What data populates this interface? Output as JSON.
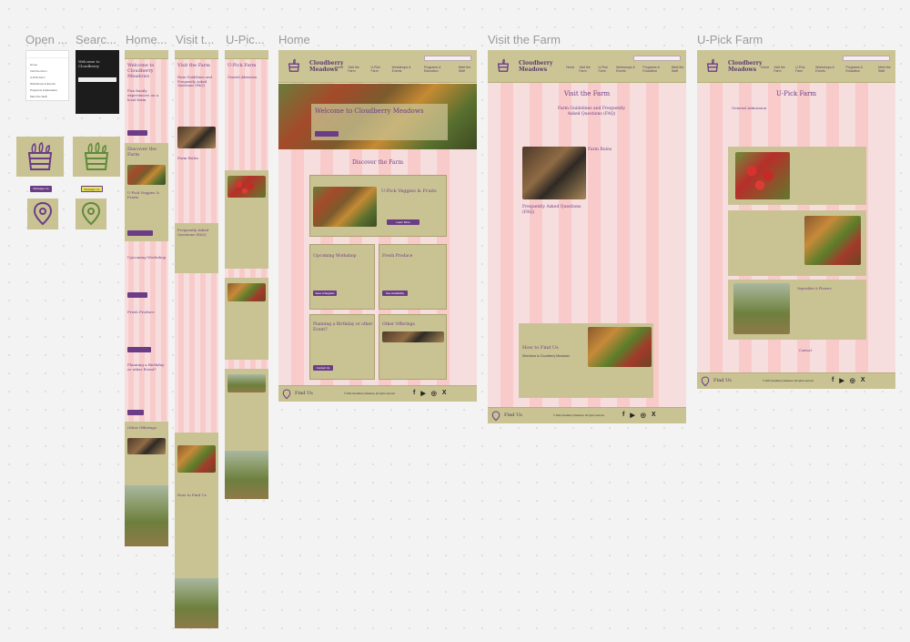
{
  "frame_labels": {
    "open": "Open ...",
    "search": "Searc...",
    "home_mobile": "Home...",
    "visit_mobile": "Visit t...",
    "upick_mobile": "U-Pic...",
    "home": "Home",
    "visit": "Visit the Farm",
    "upick": "U-Pick Farm"
  },
  "brand": {
    "line1": "Cloudberry",
    "line2": "Meadows"
  },
  "nav": [
    "Home",
    "Visit the Farm",
    "U-Pick Farm",
    "Workshops & Events",
    "Programs & Education",
    "Meet the Staff"
  ],
  "components": {
    "message_btn_purple": "Message me",
    "message_btn_yellow": "Message me"
  },
  "home": {
    "hero_title": "Welcome to Cloudberry Meadows",
    "discover_title": "Discover the Farm",
    "upick_title": "U-Pick Veggies & Fruits",
    "upick_btn": "Learn More",
    "workshop_title": "Upcoming Workshop",
    "workshop_btn": "Save A Register",
    "fresh_title": "Fresh Produce",
    "fresh_btn": "See Availability",
    "planning_title": "Planning a Birthday or other Event?",
    "planning_btn": "Contact Us",
    "other_title": "Other Offerings"
  },
  "visit": {
    "title": "Visit the Farm",
    "faq_title": "Farm Guidelines and Frequently Asked Questions (FAQ)",
    "farm_rules": "Farm Rules",
    "faq2": "Frequently Asked Questions (FAQ)",
    "find_us": "How to Find Us",
    "directions": "Directions to Cloudberry Meadows"
  },
  "upick": {
    "title": "U-Pick Farm",
    "admission": "General Admission",
    "veggies": "Vegetables & Flowers",
    "contact": "Contact"
  },
  "mobile": {
    "home_title": "Welcome to Cloudberry Meadows",
    "home_sub": "Fun family experiences on a local farm",
    "discover": "Discover the Farm",
    "upick": "U-Pick Veggies & Fruits",
    "workshop": "Upcoming Workshop",
    "fresh": "Fresh Produce",
    "planning": "Planning a Birthday or other Event?",
    "other": "Other Offerings",
    "visit_title": "Visit the Farm",
    "faq": "Farm Guidelines and Frequently Asked Questions (FAQ)",
    "farm_rules": "Farm Rules",
    "faq2": "Frequently Asked Questions (FAQ)",
    "find_us": "How to Find Us",
    "upick_title": "U-Pick Farm",
    "admission": "General Admission",
    "search_title": "Welcome to Cloudberry"
  },
  "footer": {
    "find_us": "Find Us",
    "copyright": "© 2024 Cloudberry Meadows. All rights reserved."
  },
  "colors": {
    "accent": "#6b3d86",
    "olive": "#c9c393",
    "pink": "#f7dede",
    "canvas": "#f3f3f3"
  }
}
